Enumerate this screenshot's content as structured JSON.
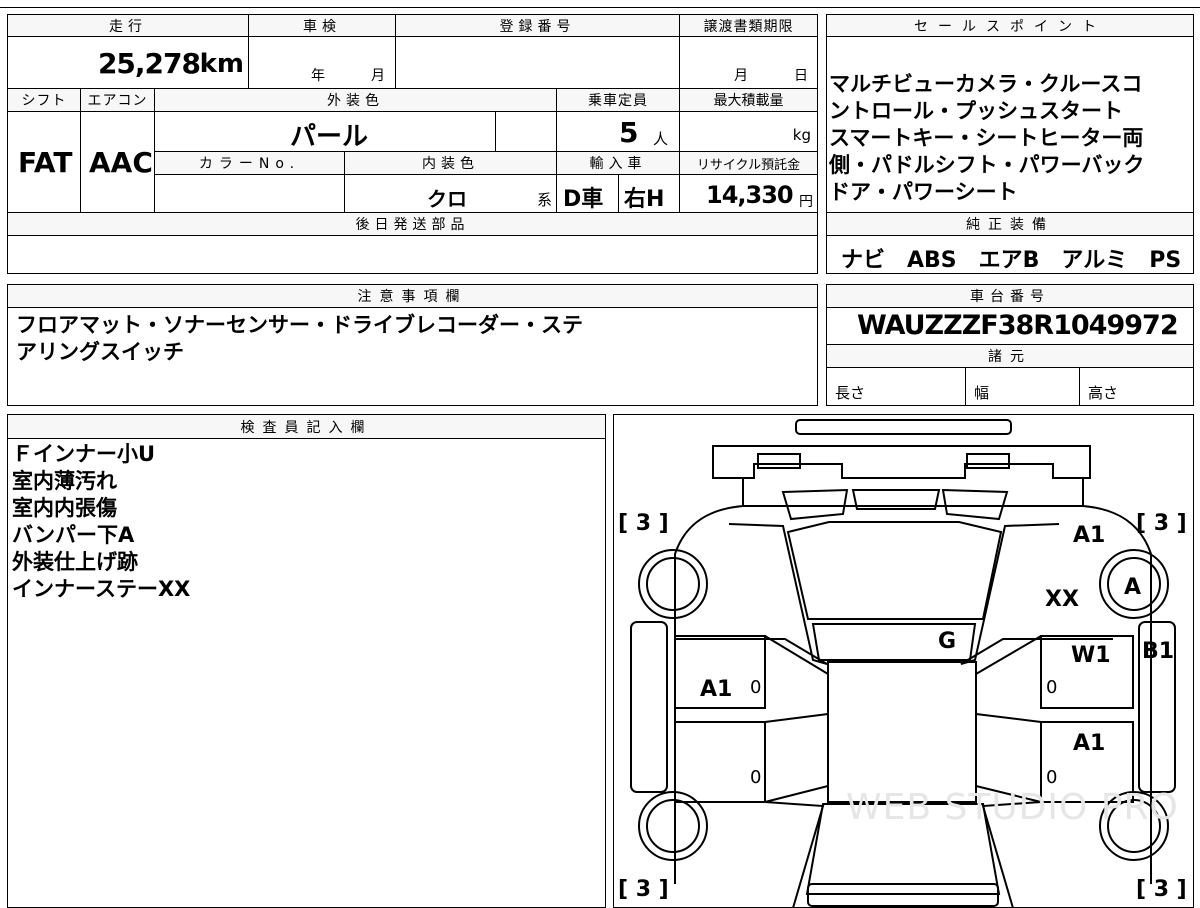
{
  "top": {
    "mileage_label": "走行",
    "mileage_value": "25,278",
    "mileage_unit": "km",
    "inspection_label": "車検",
    "inspection_year": "年",
    "inspection_month": "月",
    "registration_label": "登録番号",
    "transfer_label": "譲渡書類期限",
    "transfer_month": "月",
    "transfer_day": "日"
  },
  "specs": {
    "shift_label": "シフト",
    "shift_value": "FAT",
    "aircon_label": "エアコン",
    "aircon_value": "AAC",
    "exterior_color_label": "外装色",
    "exterior_color_value": "パール",
    "capacity_label": "乗車定員",
    "capacity_value": "5",
    "capacity_unit": "人",
    "max_load_label": "最大積載量",
    "max_load_unit": "kg",
    "color_no_label": "カラーNo.",
    "interior_color_label": "内装色",
    "interior_color_value": "クロ",
    "interior_color_suffix": "系",
    "import_label": "輸入車",
    "import_value": "D車",
    "steering_value": "右H",
    "recycle_label": "リサイクル預託金",
    "recycle_value": "14,330",
    "recycle_unit": "円",
    "later_parts_label": "後日発送部品"
  },
  "sales_points": {
    "label": "セールスポイント",
    "lines": [
      "マルチビューカメラ・クルースコ",
      "ントロール・プッシュスタート",
      "スマートキー・シートヒーター両",
      "側・パドルシフト・パワーバック",
      "ドア・パワーシート"
    ]
  },
  "genuine_equipment": {
    "label": "純正装備",
    "value": "ナビ　ABS　エアB　アルミ　PS　PW"
  },
  "notes": {
    "label": "注意事項欄",
    "lines": [
      "フロアマット・ソナーセンサー・ドライブレコーダー・ステ",
      "アリングスイッチ"
    ]
  },
  "chassis": {
    "label": "車台番号",
    "value": "WAUZZZF38R1049972",
    "specs_label": "諸元",
    "length_label": "長さ",
    "width_label": "幅",
    "height_label": "高さ"
  },
  "inspector": {
    "label": "検査員記入欄",
    "lines": [
      "Ｆインナー小U",
      "室内薄汚れ",
      "室内内張傷",
      "バンパー下A",
      "外装仕上げ跡",
      "インナーステーXX"
    ]
  },
  "diagram": {
    "tire_front_left": "[ 3 ]",
    "tire_front_right": "[ 3 ]",
    "tire_rear_left": "[ 3 ]",
    "tire_rear_right": "[ 3 ]",
    "mark_front_right_fender": "A1",
    "mark_front_right_inner": "XX",
    "mark_front_right_wheel": "A",
    "mark_roof": "G",
    "mark_right_front_door": "W1",
    "mark_right_step": "B1",
    "mark_left_front_door": "A1",
    "mark_right_rear_door": "A1",
    "mark_zero": "0",
    "watermark": "WEB STUDIO PRO"
  }
}
